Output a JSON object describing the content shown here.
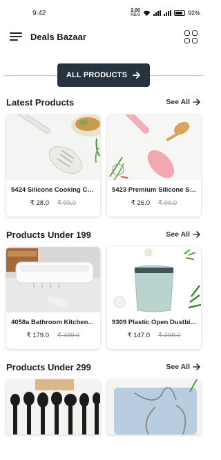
{
  "status": {
    "time": "9:42",
    "speed_top": "2.00",
    "speed_unit": "KB/S",
    "battery": "92%"
  },
  "app": {
    "title": "Deals Bazaar"
  },
  "all_products_label": "ALL PRODUCTS",
  "sections": [
    {
      "title": "Latest Products",
      "see_all": "See All",
      "products": [
        {
          "name": "5424 Silicone Cooking Coo...",
          "price": "₹ 28.0",
          "mrp": "₹ 99.0"
        },
        {
          "name": "5423 Premium Silicone Sp...",
          "price": "₹ 26.0",
          "mrp": "₹ 99.0"
        }
      ]
    },
    {
      "title": "Products Under 199",
      "see_all": "See All",
      "products": [
        {
          "name": "4058a Bathroom Kitchen...",
          "price": "₹ 179.0",
          "mrp": "₹ 499.0"
        },
        {
          "name": "9309 Plastic Open Dustbi...",
          "price": "₹ 147.0",
          "mrp": "₹ 299.0"
        }
      ]
    },
    {
      "title": "Products Under 299",
      "see_all": "See All"
    }
  ],
  "colors": {
    "primary_button": "#27323f",
    "divider": "#c7c9e8"
  }
}
